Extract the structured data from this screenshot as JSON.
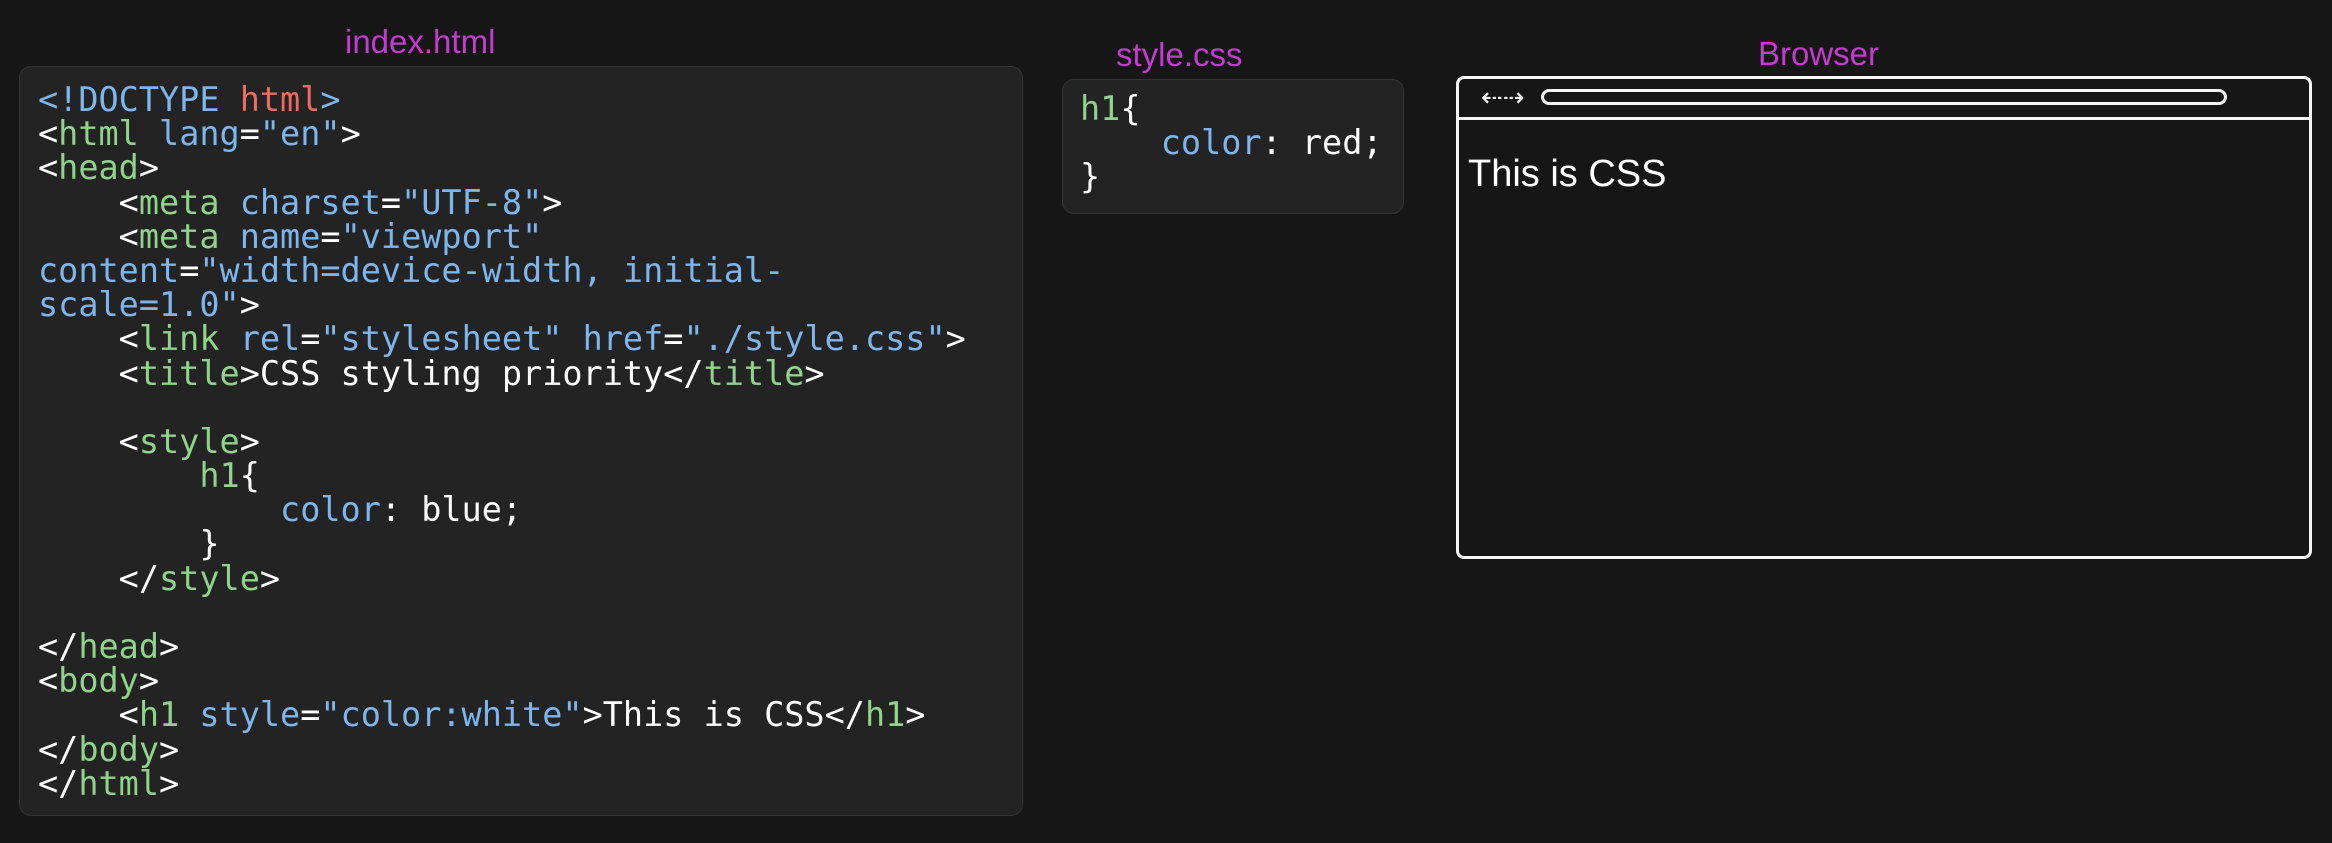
{
  "labels": {
    "index_html": "index.html",
    "style_css": "style.css",
    "browser": "Browser"
  },
  "index_html_code": [
    [
      {
        "t": "<!DOCTYPE ",
        "c": "blue"
      },
      {
        "t": "html",
        "c": "red"
      },
      {
        "t": ">",
        "c": "blue"
      }
    ],
    [
      {
        "t": "<",
        "c": "white"
      },
      {
        "t": "html",
        "c": "green"
      },
      {
        "t": " ",
        "c": "white"
      },
      {
        "t": "lang",
        "c": "blue"
      },
      {
        "t": "=",
        "c": "white"
      },
      {
        "t": "\"en\"",
        "c": "blue"
      },
      {
        "t": ">",
        "c": "white"
      }
    ],
    [
      {
        "t": "<",
        "c": "white"
      },
      {
        "t": "head",
        "c": "green"
      },
      {
        "t": ">",
        "c": "white"
      }
    ],
    [
      {
        "t": "    <",
        "c": "white"
      },
      {
        "t": "meta",
        "c": "green"
      },
      {
        "t": " ",
        "c": "white"
      },
      {
        "t": "charset",
        "c": "blue"
      },
      {
        "t": "=",
        "c": "white"
      },
      {
        "t": "\"UTF-8\"",
        "c": "blue"
      },
      {
        "t": ">",
        "c": "white"
      }
    ],
    [
      {
        "t": "    <",
        "c": "white"
      },
      {
        "t": "meta",
        "c": "green"
      },
      {
        "t": " ",
        "c": "white"
      },
      {
        "t": "name",
        "c": "blue"
      },
      {
        "t": "=",
        "c": "white"
      },
      {
        "t": "\"viewport\"",
        "c": "blue"
      }
    ],
    [
      {
        "t": "content",
        "c": "blue"
      },
      {
        "t": "=",
        "c": "white"
      },
      {
        "t": "\"width=device-width, initial-",
        "c": "blue"
      }
    ],
    [
      {
        "t": "scale=1.0\"",
        "c": "blue"
      },
      {
        "t": ">",
        "c": "white"
      }
    ],
    [
      {
        "t": "    <",
        "c": "white"
      },
      {
        "t": "link",
        "c": "green"
      },
      {
        "t": " ",
        "c": "white"
      },
      {
        "t": "rel",
        "c": "blue"
      },
      {
        "t": "=",
        "c": "white"
      },
      {
        "t": "\"stylesheet\"",
        "c": "blue"
      },
      {
        "t": " ",
        "c": "white"
      },
      {
        "t": "href",
        "c": "blue"
      },
      {
        "t": "=",
        "c": "white"
      },
      {
        "t": "\"./style.css\"",
        "c": "blue"
      },
      {
        "t": ">",
        "c": "white"
      }
    ],
    [
      {
        "t": "    <",
        "c": "white"
      },
      {
        "t": "title",
        "c": "green"
      },
      {
        "t": ">CSS styling priority</",
        "c": "white"
      },
      {
        "t": "title",
        "c": "green"
      },
      {
        "t": ">",
        "c": "white"
      }
    ],
    [],
    [
      {
        "t": "    <",
        "c": "white"
      },
      {
        "t": "style",
        "c": "green"
      },
      {
        "t": ">",
        "c": "white"
      }
    ],
    [
      {
        "t": "        ",
        "c": "white"
      },
      {
        "t": "h1",
        "c": "green"
      },
      {
        "t": "{",
        "c": "white"
      }
    ],
    [
      {
        "t": "            ",
        "c": "white"
      },
      {
        "t": "color",
        "c": "blue"
      },
      {
        "t": ": blue;",
        "c": "white"
      }
    ],
    [
      {
        "t": "        }",
        "c": "white"
      }
    ],
    [
      {
        "t": "    </",
        "c": "white"
      },
      {
        "t": "style",
        "c": "green"
      },
      {
        "t": ">",
        "c": "white"
      }
    ],
    [],
    [
      {
        "t": "</",
        "c": "white"
      },
      {
        "t": "head",
        "c": "green"
      },
      {
        "t": ">",
        "c": "white"
      }
    ],
    [
      {
        "t": "<",
        "c": "white"
      },
      {
        "t": "body",
        "c": "green"
      },
      {
        "t": ">",
        "c": "white"
      }
    ],
    [
      {
        "t": "    <",
        "c": "white"
      },
      {
        "t": "h1",
        "c": "green"
      },
      {
        "t": " ",
        "c": "white"
      },
      {
        "t": "style",
        "c": "blue"
      },
      {
        "t": "=",
        "c": "white"
      },
      {
        "t": "\"color:white\"",
        "c": "blue"
      },
      {
        "t": ">This is CSS</",
        "c": "white"
      },
      {
        "t": "h1",
        "c": "green"
      },
      {
        "t": ">",
        "c": "white"
      }
    ],
    [
      {
        "t": "</",
        "c": "white"
      },
      {
        "t": "body",
        "c": "green"
      },
      {
        "t": ">",
        "c": "white"
      }
    ],
    [
      {
        "t": "</",
        "c": "white"
      },
      {
        "t": "html",
        "c": "green"
      },
      {
        "t": ">",
        "c": "white"
      }
    ]
  ],
  "style_css_code": [
    [
      {
        "t": "h1",
        "c": "green"
      },
      {
        "t": "{",
        "c": "white"
      }
    ],
    [
      {
        "t": "    ",
        "c": "white"
      },
      {
        "t": "color",
        "c": "blue"
      },
      {
        "t": ": red;",
        "c": "white"
      }
    ],
    [
      {
        "t": "}",
        "c": "white"
      }
    ]
  ],
  "browser": {
    "nav_icon": "left-right-arrow-icon",
    "nav_glyph": "⇠⇢",
    "content": "This is CSS"
  }
}
